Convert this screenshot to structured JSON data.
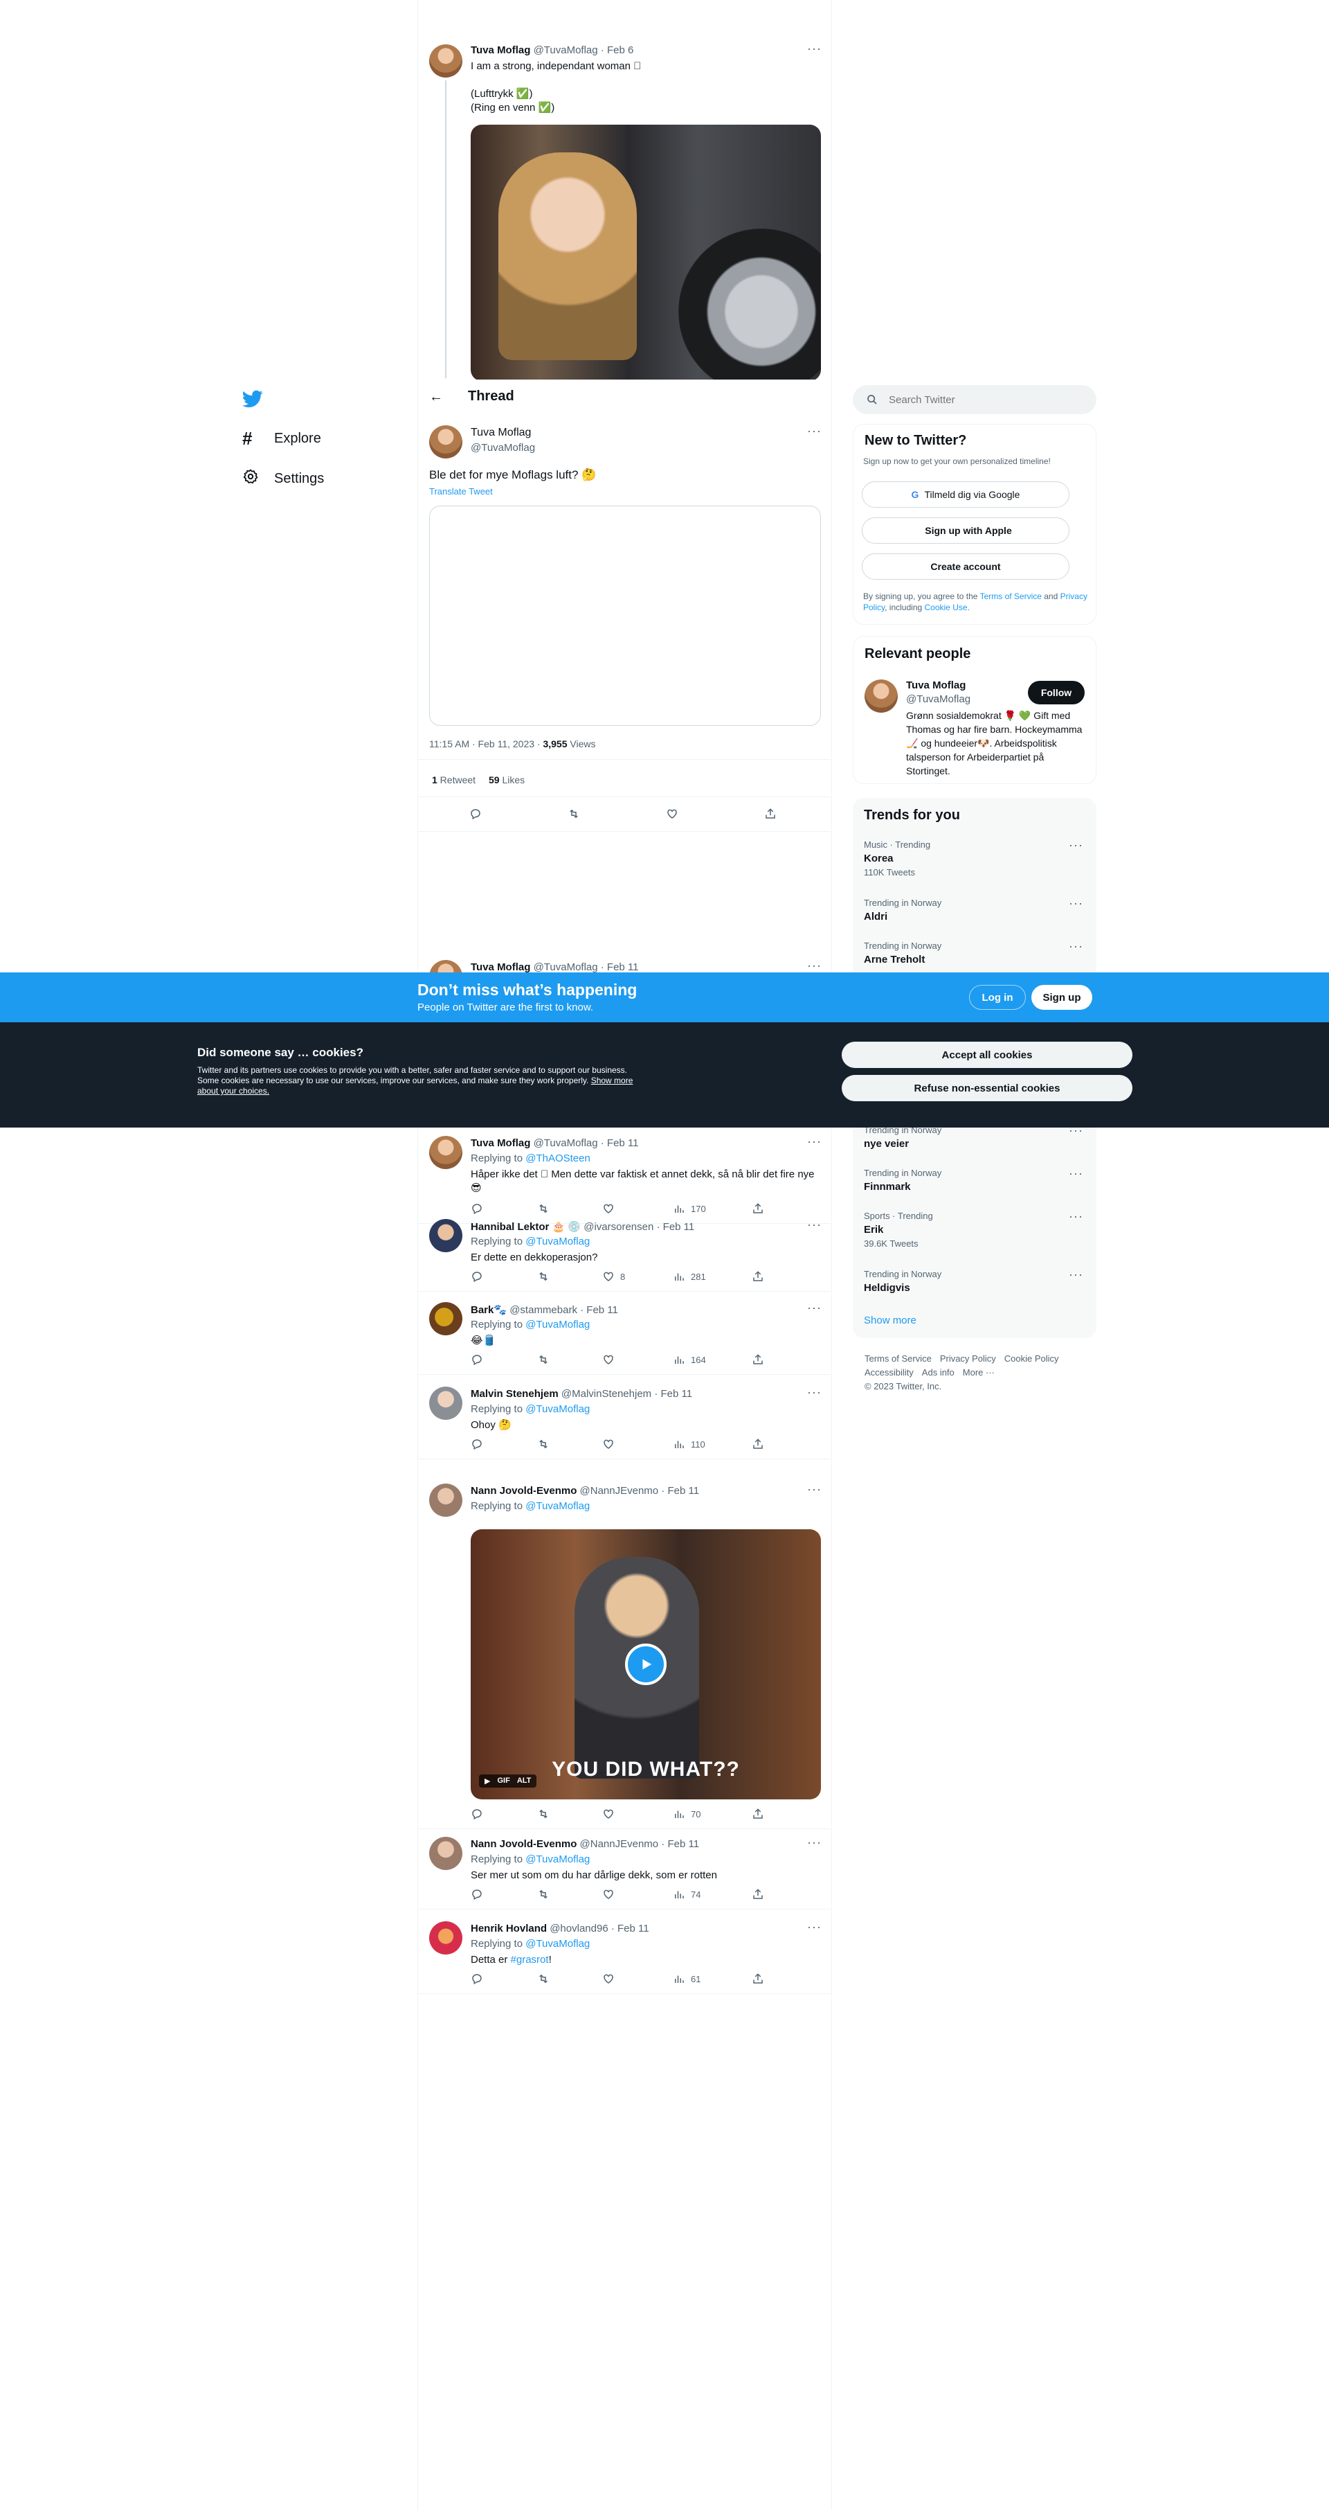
{
  "nav": {
    "explore": "Explore",
    "settings": "Settings"
  },
  "thread_header": {
    "title": "Thread"
  },
  "top_tweet": {
    "name": "Tuva Moflag",
    "handle": "@TuvaMoflag",
    "date": "Feb 6",
    "text1": "I am a strong, independant woman 🏻",
    "text2": "(Lufttrykk ✅)",
    "text3": "(Ring en venn ✅)"
  },
  "main_tweet": {
    "name": "Tuva Moflag",
    "handle": "@TuvaMoflag",
    "text": "Ble det for mye Moflags luft? 🤔",
    "translate": "Translate Tweet",
    "time": "11:15 AM · Feb 11, 2023 · ",
    "views_count": "3,955",
    "views_label": " Views",
    "retweets_count": "1",
    "retweets_label": " Retweet",
    "likes_count": "59",
    "likes_label": " Likes"
  },
  "hidden_reply": {
    "name": "Tuva Moflag",
    "meta": "@TuvaMoflag · Feb 11"
  },
  "banner": {
    "title": "Don’t miss what’s happening",
    "subtitle": "People on Twitter are the first to know.",
    "login": "Log in",
    "signup": "Sign up"
  },
  "cookies": {
    "title": "Did someone say … cookies?",
    "body": "Twitter and its partners use cookies to provide you with a better, safer and faster service and to support our business. Some cookies are necessary to use our services, improve our services, and make sure they work properly.",
    "link": "Show more about your choices.",
    "accept": "Accept all cookies",
    "refuse": "Refuse non-essential cookies"
  },
  "replies": [
    {
      "name": "Tuva Moflag",
      "meta": "@TuvaMoflag · Feb 11",
      "replying": "Replying to ",
      "to": "@ThAOSteen",
      "text": "Håper ikke det 🏻 Men dette var faktisk et annet dekk, så nå blir det fire nye 😎",
      "likes": "",
      "views": "170"
    },
    {
      "name": "Hannibal Lektor 🎂 💿",
      "meta": "@ivarsorensen · Feb 11",
      "replying": "Replying to ",
      "to": "@TuvaMoflag",
      "text": "Er dette en dekkoperasjon?",
      "likes": "8",
      "views": "281"
    },
    {
      "name": "Bark🐾",
      "meta": "@stammebark · Feb 11",
      "replying": "Replying to ",
      "to": "@TuvaMoflag",
      "text": "😂🛢️",
      "likes": "",
      "views": "164"
    },
    {
      "name": "Malvin Stenehjem",
      "meta": "@MalvinStenehjem · Feb 11",
      "replying": "Replying to ",
      "to": "@TuvaMoflag",
      "text": "Ohoy 🤔",
      "likes": "",
      "views": "110"
    },
    {
      "name": "Nann Jovold-Evenmo",
      "meta": "@NannJEvenmo · Feb 11",
      "replying": "Replying to ",
      "to": "@TuvaMoflag",
      "text": "",
      "likes": "",
      "views": "70",
      "gif_caption": "YOU DID WHAT??",
      "gif_tag": "GIF",
      "alt_tag": "ALT"
    },
    {
      "name": "Nann Jovold-Evenmo",
      "meta": "@NannJEvenmo · Feb 11",
      "replying": "Replying to ",
      "to": "@TuvaMoflag",
      "text": "Ser mer ut som om du har dårlige dekk, som er rotten",
      "likes": "",
      "views": "74"
    },
    {
      "name": "Henrik Hovland",
      "meta": "@hovland96 · Feb 11",
      "replying": "Replying to ",
      "to": "@TuvaMoflag",
      "text_pre": "Detta er ",
      "hashtag": "#grasrot",
      "text_post": "!",
      "likes": "",
      "views": "61"
    }
  ],
  "search": {
    "placeholder": "Search Twitter"
  },
  "new_to_twitter": {
    "title": "New to Twitter?",
    "subtitle": "Sign up now to get your own personalized timeline!",
    "google": "Tilmeld dig via Google",
    "apple": "Sign up with Apple",
    "create": "Create account",
    "legal_pre": "By signing up, you agree to the ",
    "tos": "Terms of Service",
    "and": " and ",
    "privacy": "Privacy Policy",
    "including": ", including ",
    "cookie_use": "Cookie Use",
    "dot": "."
  },
  "relevant": {
    "title": "Relevant people",
    "name": "Tuva Moflag",
    "handle": "@TuvaMoflag",
    "follow": "Follow",
    "bio": "Grønn sosialdemokrat 🌹 💚 Gift med Thomas og har fire barn. Hockeymamma🏒 og hundeeier🐶. Arbeidspolitisk talsperson for Arbeiderpartiet på Stortinget."
  },
  "trends": {
    "title": "Trends for you",
    "items_top": [
      {
        "cat": "Music · Trending",
        "name": "Korea",
        "count": "110K Tweets"
      },
      {
        "cat": "Trending in Norway",
        "name": "Aldri",
        "count": ""
      },
      {
        "cat": "Trending in Norway",
        "name": "Arne Treholt",
        "count": ""
      }
    ],
    "items_bottom": [
      {
        "cat": "Trending in Norway",
        "name": "nye veier",
        "count": ""
      },
      {
        "cat": "Trending in Norway",
        "name": "Finnmark",
        "count": ""
      },
      {
        "cat": "Sports · Trending",
        "name": "Erik",
        "count": "39.6K Tweets"
      },
      {
        "cat": "Trending in Norway",
        "name": "Heldigvis",
        "count": ""
      }
    ],
    "show_more": "Show more"
  },
  "footer": {
    "tos": "Terms of Service",
    "privacy": "Privacy Policy",
    "cookie": "Cookie Policy",
    "access": "Accessibility",
    "ads": "Ads info",
    "more": "More ···",
    "copy": "© 2023 Twitter, Inc."
  },
  "colors": {
    "accent": "#1d9bf0",
    "dark": "#0f1419",
    "banner": "#1d9bf0"
  }
}
